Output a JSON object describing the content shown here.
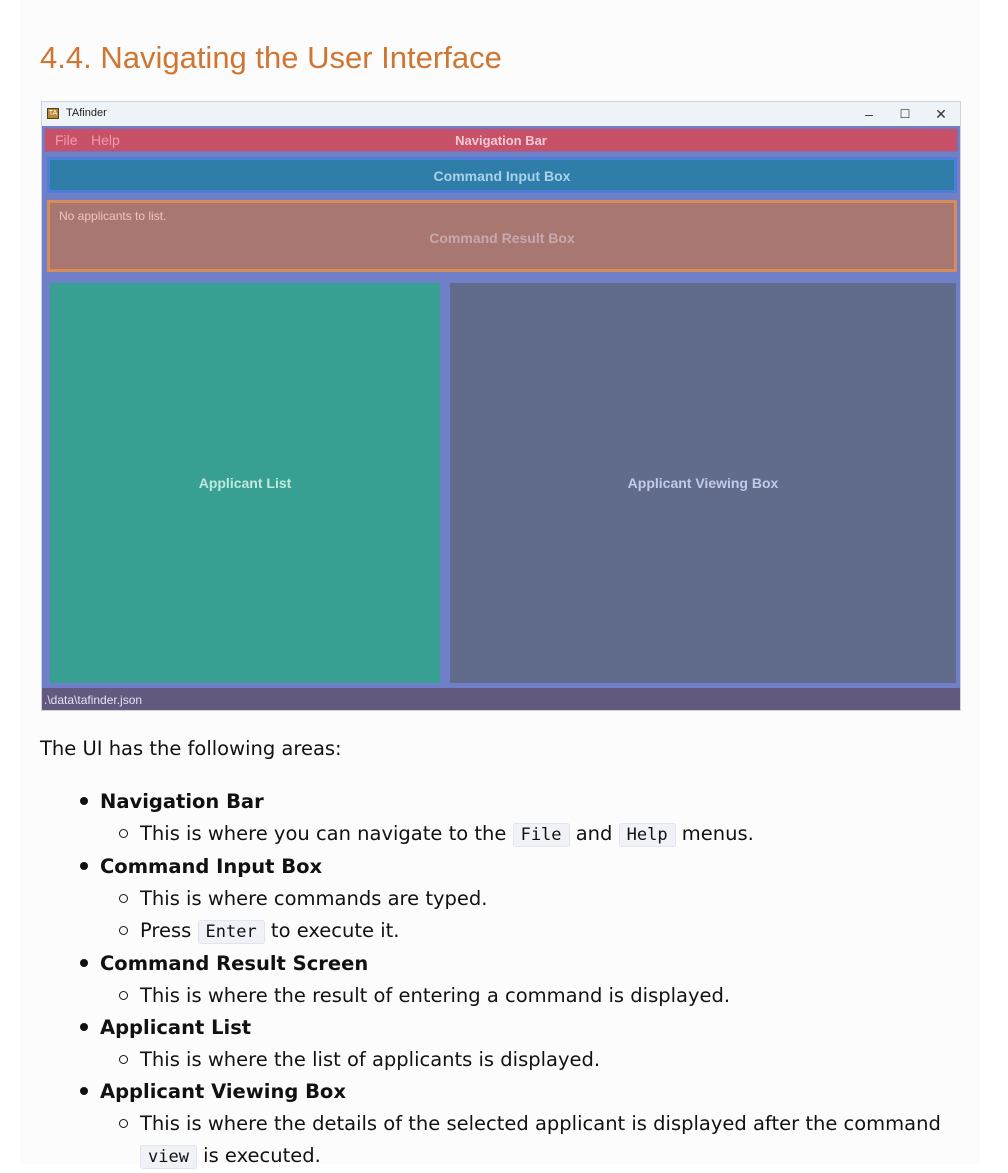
{
  "section_title": "4.4. Navigating the User Interface",
  "screenshot": {
    "window_title": "TAfinder",
    "app_icon_text": "TA",
    "window_controls": {
      "minimize": "–",
      "maximize": "☐",
      "close": "✕"
    },
    "menu": {
      "file": "File",
      "help": "Help"
    },
    "labels": {
      "navigation_bar": "Navigation Bar",
      "command_input_box": "Command Input Box",
      "command_result_box": "Command Result Box",
      "applicant_list": "Applicant List",
      "applicant_viewing_box": "Applicant Viewing Box"
    },
    "result_message": "No applicants to list.",
    "status_path": ".\\data\\tafinder.json",
    "colors": {
      "navigation_bar": "#c75268",
      "command_input_box": "#2f7ea9",
      "command_result_box": "#a87772",
      "applicant_list": "#38a092",
      "applicant_viewing_box": "#616b8b"
    }
  },
  "intro": "The UI has the following areas:",
  "areas": [
    {
      "name": "Navigation Bar",
      "points": [
        {
          "before": "This is where you can navigate to the ",
          "code1": "File",
          "mid": " and ",
          "code2": "Help",
          "after": " menus."
        }
      ]
    },
    {
      "name": "Command Input Box",
      "points": [
        {
          "text": "This is where commands are typed."
        },
        {
          "before": "Press ",
          "code1": "Enter",
          "after": " to execute it."
        }
      ]
    },
    {
      "name": "Command Result Screen",
      "points": [
        {
          "text": "This is where the result of entering a command is displayed."
        }
      ]
    },
    {
      "name": "Applicant List",
      "points": [
        {
          "text": "This is where the list of applicants is displayed."
        }
      ]
    },
    {
      "name": "Applicant Viewing Box",
      "points": [
        {
          "before": "This is where the details of the selected applicant is displayed after the command ",
          "code1": "view",
          "after": " is executed."
        }
      ]
    }
  ]
}
